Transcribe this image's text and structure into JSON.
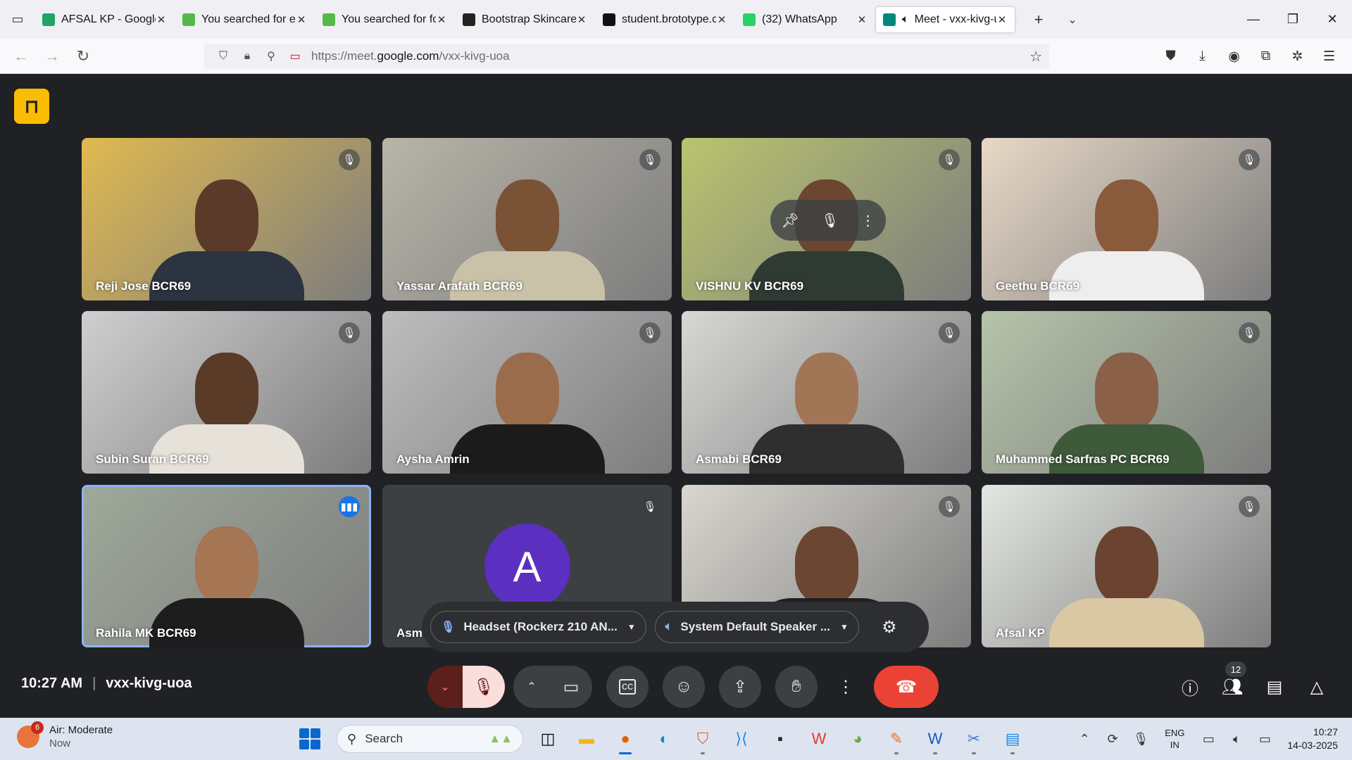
{
  "browser": {
    "tabs": [
      {
        "label": "AFSAL KP - Google Dri",
        "favicon_color": "#1fa463",
        "active": false
      },
      {
        "label": "You searched for e cor",
        "favicon_color": "#55b949",
        "active": false
      },
      {
        "label": "You searched for footv",
        "favicon_color": "#55b949",
        "active": false
      },
      {
        "label": "Bootstrap Skincare Ecc",
        "favicon_color": "#222222",
        "active": false
      },
      {
        "label": "student.brototype.com",
        "favicon_color": "#111111",
        "active": false
      },
      {
        "label": "(32) WhatsApp",
        "favicon_color": "#25d366",
        "active": false
      },
      {
        "label": "Meet - vxx-kivg-uc",
        "favicon_color": "#00897b",
        "active": true
      }
    ],
    "url_prefix": "https://meet.",
    "url_domain": "google.com",
    "url_path": "/vxx-kivg-uoa"
  },
  "meet": {
    "participants": [
      {
        "name": "Reji Jose BCR69",
        "bg": "#e0b94f",
        "skin": "#5b3a2a",
        "shirt": "#2b3440",
        "speaking": false
      },
      {
        "name": "Yassar Arafath BCR69",
        "bg": "#b8b4a8",
        "skin": "#7a5236",
        "shirt": "#c9c2a8",
        "speaking": false
      },
      {
        "name": "VISHNU KV BCR69",
        "bg": "#b9c46e",
        "skin": "#6b4630",
        "shirt": "#2f3a33",
        "speaking": false
      },
      {
        "name": "Geethu BCR69",
        "bg": "#e8d8c6",
        "skin": "#8a5a3c",
        "shirt": "#eeeeee",
        "speaking": false
      },
      {
        "name": "Subin Suran BCR69",
        "bg": "#cfcfcf",
        "skin": "#5a3b28",
        "shirt": "#e6e2da",
        "speaking": false
      },
      {
        "name": "Aysha Amrin",
        "bg": "#bdbdbd",
        "skin": "#9a6c4c",
        "shirt": "#1b1b1b",
        "speaking": false
      },
      {
        "name": "Asmabi BCR69",
        "bg": "#d7d7d5",
        "skin": "#a07657",
        "shirt": "#2f2f2f",
        "speaking": false
      },
      {
        "name": "Muhammed Sarfras PC BCR69",
        "bg": "#b5c4a9",
        "skin": "#8a6048",
        "shirt": "#3f5a3a",
        "speaking": false
      },
      {
        "name": "Rahila MK BCR69",
        "bg": "#9fa99a",
        "skin": "#a57554",
        "shirt": "#1d1d1d",
        "speaking": true
      },
      {
        "name": "Asm",
        "avatar_letter": "A",
        "speaking": false
      },
      {
        "name": "",
        "bg": "#d9d6cf",
        "skin": "#6b4632",
        "shirt": "#1f1f1f",
        "speaking": false
      },
      {
        "name": "Afsal KP",
        "bg": "#e3e6e2",
        "skin": "#6a4430",
        "shirt": "#d9c8a3",
        "speaking": false
      }
    ],
    "audio_input": "Headset (Rockerz 210 AN...",
    "audio_output": "System Default Speaker ...",
    "time": "10:27 AM",
    "meeting_code": "vxx-kivg-uoa",
    "participant_count": "12"
  },
  "taskbar": {
    "weather_title": "Air: Moderate",
    "weather_sub": "Now",
    "weather_badge": "6",
    "search_placeholder": "Search",
    "lang_1": "ENG",
    "lang_2": "IN",
    "clock_time": "10:27",
    "clock_date": "14-03-2025"
  }
}
